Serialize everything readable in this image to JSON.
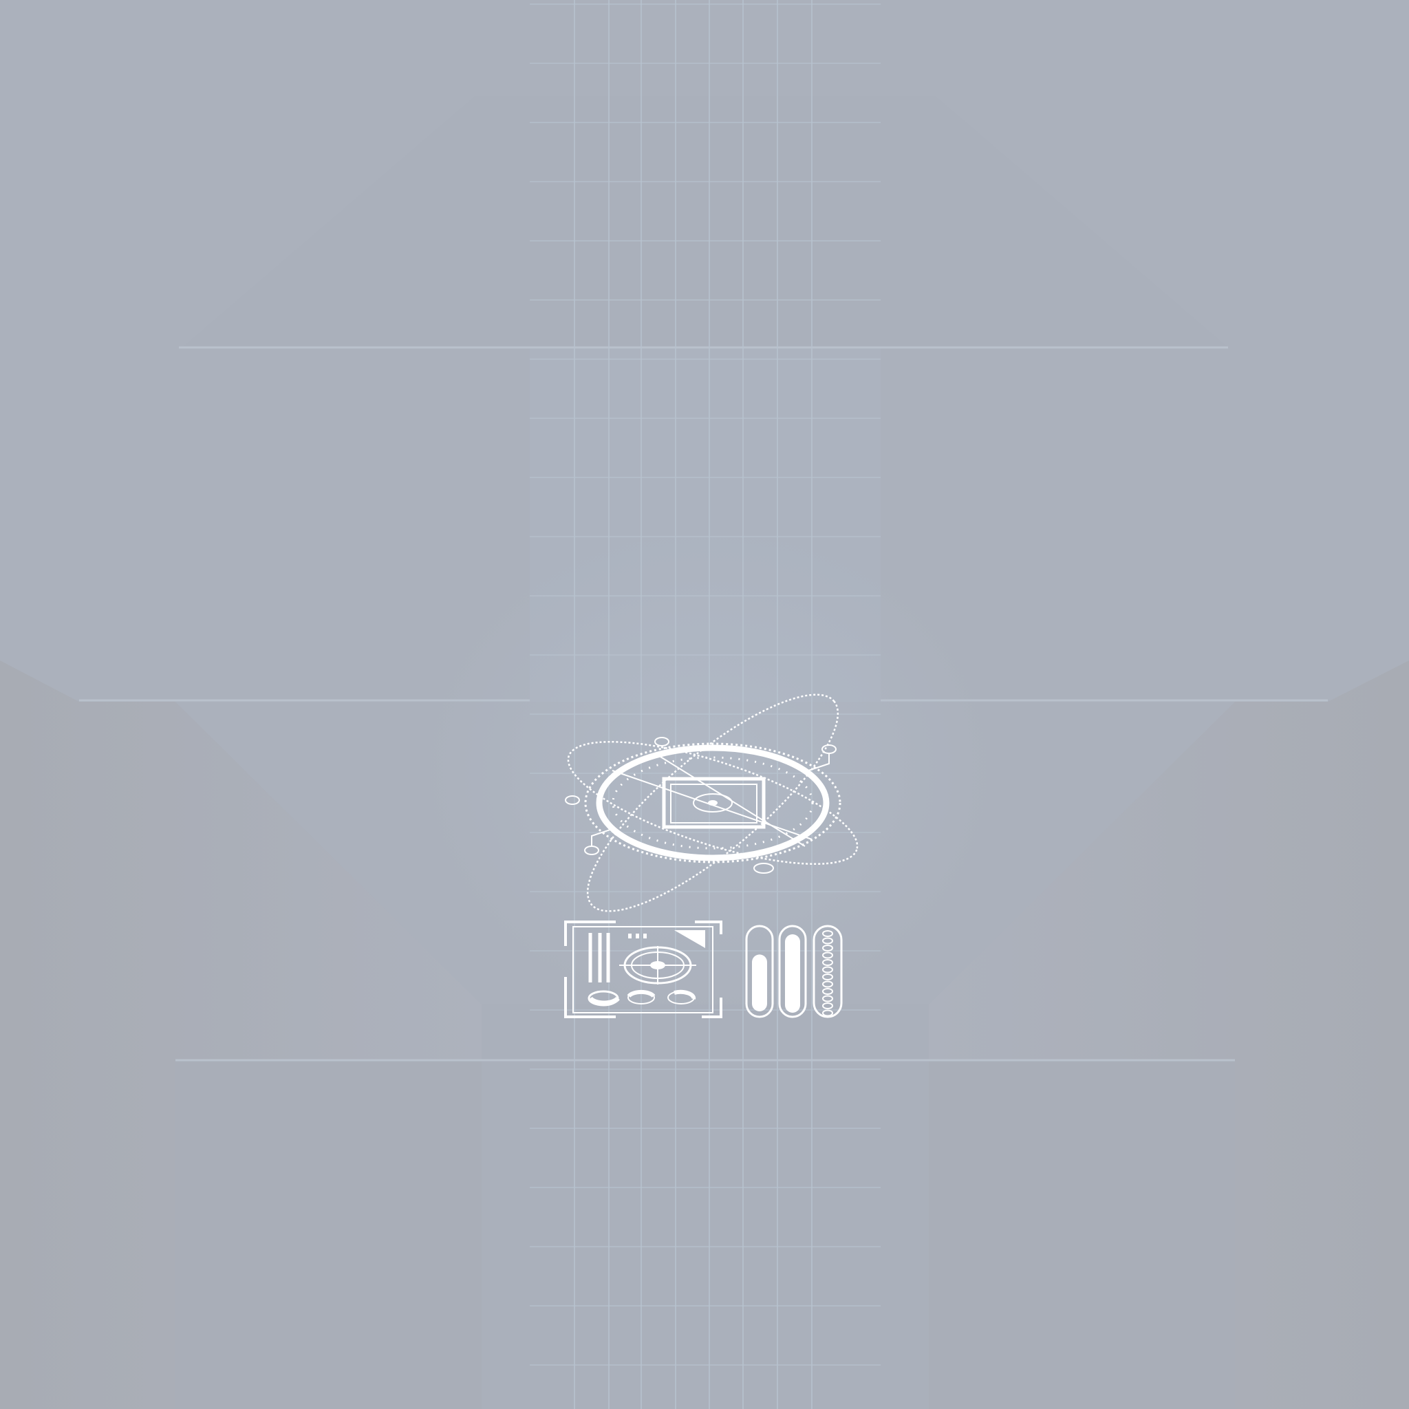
{
  "scene": {
    "description_colors": {
      "background": "#aab0bb",
      "panel_dark": "#a9acb4",
      "panel_light": "#adb4c0",
      "grid_line": "#b7c2cf",
      "hud_white": "#ffffff"
    },
    "icons": {
      "core": "atom-reticle-icon",
      "panel": "crosshair-panel-icon",
      "gauges": "capsule-gauge-icon"
    },
    "gauges": {
      "gauge_1_fill": 0.7,
      "gauge_2_fill": 0.95,
      "gauge_3_segments": 12
    }
  }
}
